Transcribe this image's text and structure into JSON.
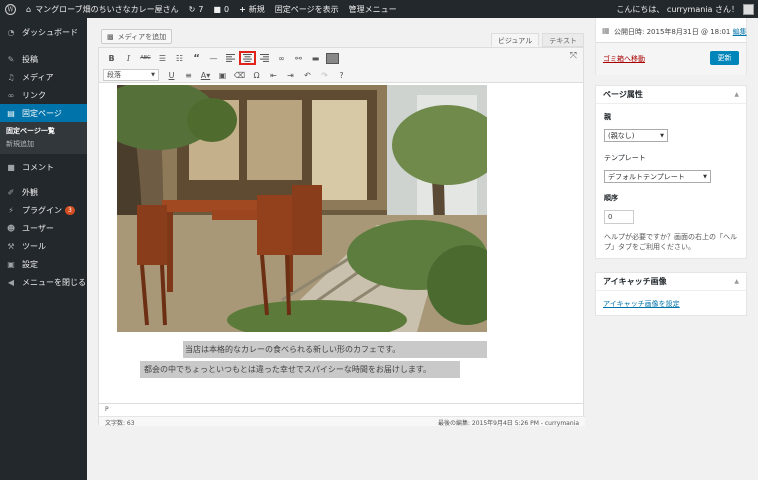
{
  "adminbar": {
    "site_name": "マングローブ畑のちいさなカレー屋さん",
    "updates_count": "7",
    "comments_count": "0",
    "new_label": "新規",
    "view_page": "固定ページを表示",
    "admin_menu": "管理メニュー",
    "greeting": "こんにちは、 currymania さん！"
  },
  "sidebar": {
    "dashboard": "ダッシュボード",
    "posts": "投稿",
    "media": "メディア",
    "links": "リンク",
    "pages": "固定ページ",
    "pages_sub": [
      "固定ページ一覧",
      "新規追加"
    ],
    "comments": "コメント",
    "appearance": "外観",
    "plugins": "プラグイン",
    "plugins_badge": "3",
    "users": "ユーザー",
    "tools": "ツール",
    "settings": "設定",
    "collapse": "メニューを閉じる"
  },
  "editor": {
    "add_media": "メディアを追加",
    "tab_visual": "ビジュアル",
    "tab_text": "テキスト",
    "format_select": "段落",
    "caption1": "当店は本格的なカレーの食べられる新しい形のカフェです。",
    "caption2": "都会の中でちょっといつもとは違った幸せでスパイシーな時間をお届けします。",
    "path": "P",
    "word_count": "文字数: 63",
    "last_edited": "最後の編集: 2015年9月4日 5:26 PM - currymania"
  },
  "publish": {
    "date": "公開日時: 2015年8月31日 @ 18:01",
    "edit_link": "編集",
    "trash": "ゴミ箱へ移動",
    "update_button": "更新"
  },
  "page_attributes": {
    "title": "ページ属性",
    "parent_label": "親",
    "parent_value": "(親なし)",
    "template_label": "テンプレート",
    "template_value": "デフォルトテンプレート",
    "order_label": "順序",
    "order_value": "0",
    "help": "ヘルプが必要ですか？画面の右上の「ヘルプ」タブをご利用ください。"
  },
  "featured_image": {
    "title": "アイキャッチ画像",
    "set_link": "アイキャッチ画像を設定"
  },
  "colors": {
    "admin_bg": "#23282d",
    "accent": "#0073aa",
    "highlight_border": "#e2231a",
    "trash": "#a00"
  }
}
